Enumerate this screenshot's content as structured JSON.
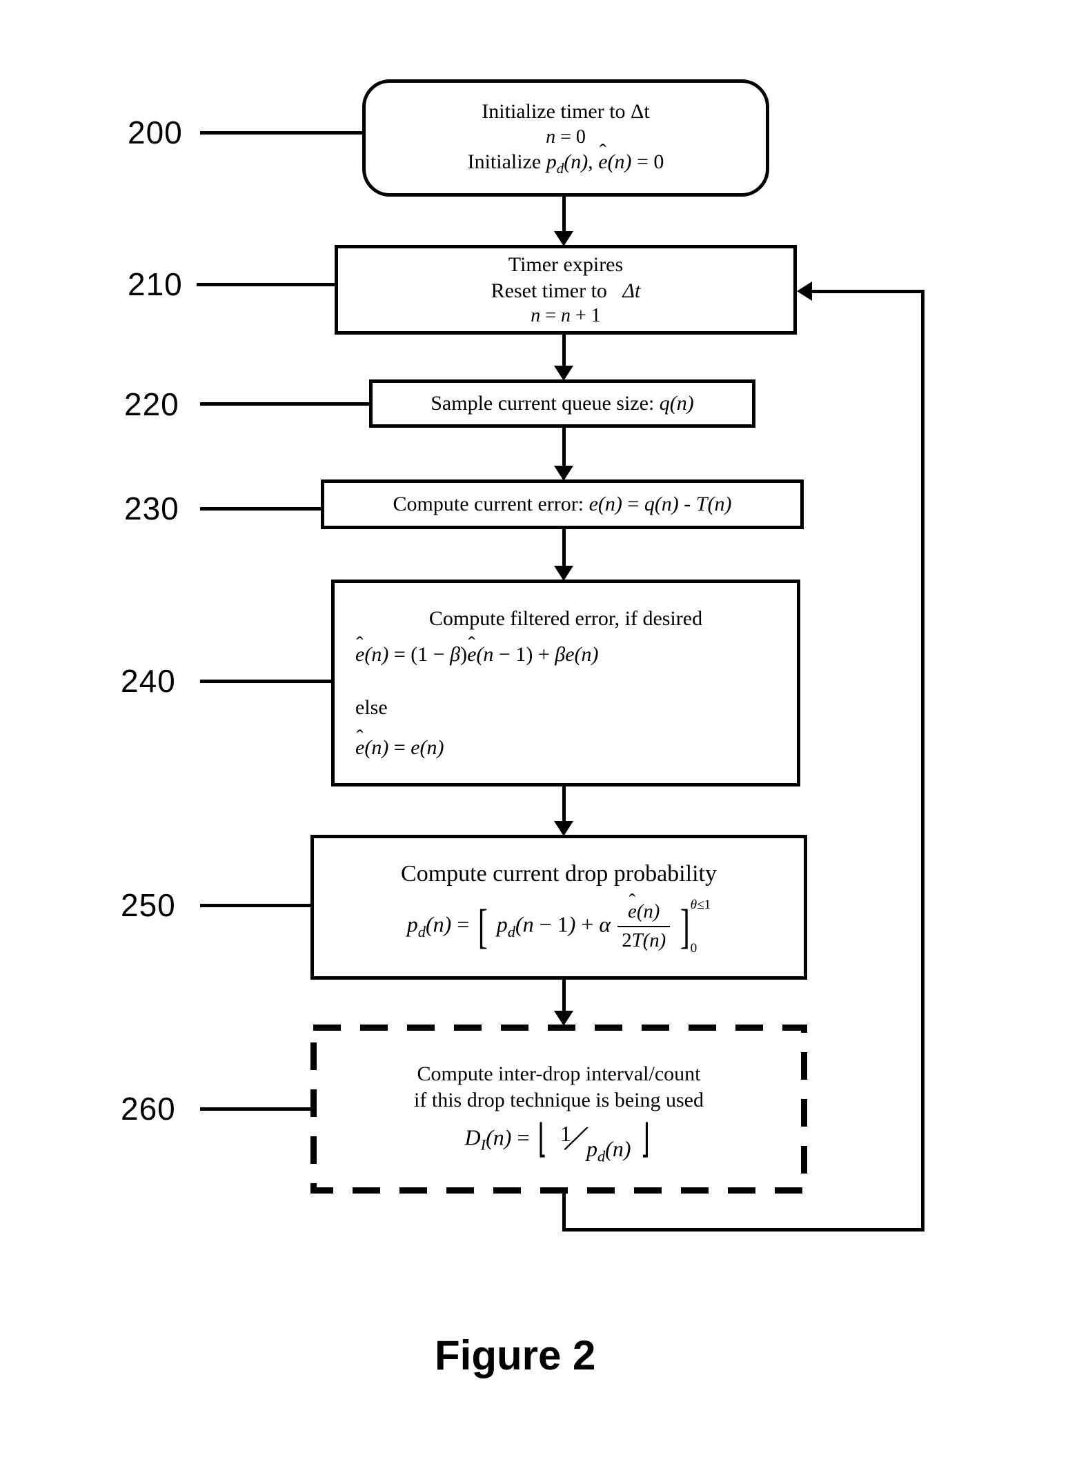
{
  "figure_caption": "Figure 2",
  "labels": {
    "l200": "200",
    "l210": "210",
    "l220": "220",
    "l230": "230",
    "l240": "240",
    "l250": "250",
    "l260": "260"
  },
  "steps": {
    "s200": {
      "line1": "Initialize timer to Δt",
      "line2": "n = 0",
      "line3_prefix": "Initialize ",
      "line3_math": "p_d(n), ê(n) = 0"
    },
    "s210": {
      "line1": "Timer expires",
      "line2_a": "Reset timer to",
      "line2_b": "Δt",
      "line3": "n = n + 1"
    },
    "s220": {
      "text": "Sample current queue size: q(n)"
    },
    "s230": {
      "text": "Compute current error: e(n) = q(n) - T(n)"
    },
    "s240": {
      "line1": "Compute filtered error, if desired",
      "eq1": "ê(n) = (1 − β) ê(n − 1) + β e(n)",
      "else": "else",
      "eq2": "ê(n) = e(n)"
    },
    "s250": {
      "line1": "Compute current drop probability",
      "eq_lhs": "p_d(n) =",
      "eq_inside_a": "p_d(n − 1) + α",
      "eq_frac_num": "ê(n)",
      "eq_frac_den": "2T(n)",
      "eq_upper": "θ ≤ 1",
      "eq_lower": "0"
    },
    "s260": {
      "line1": "Compute inter-drop interval/count",
      "line2": "if this drop technique is being used",
      "eq_lhs": "D_I(n) =",
      "eq_num": "1",
      "eq_den": "p_d(n)"
    }
  },
  "chart_data": {
    "type": "flowchart",
    "title": "Figure 2",
    "nodes": [
      {
        "id": "200",
        "shape": "rounded-rect",
        "text": "Initialize timer to Δt; n = 0; Initialize p_d(n), ê(n) = 0"
      },
      {
        "id": "210",
        "shape": "rect",
        "text": "Timer expires; Reset timer to Δt; n = n + 1"
      },
      {
        "id": "220",
        "shape": "rect",
        "text": "Sample current queue size: q(n)"
      },
      {
        "id": "230",
        "shape": "rect",
        "text": "Compute current error: e(n) = q(n) − T(n)"
      },
      {
        "id": "240",
        "shape": "rect",
        "text": "Compute filtered error, if desired: ê(n) = (1 − β) ê(n − 1) + β e(n); else ê(n) = e(n)"
      },
      {
        "id": "250",
        "shape": "rect",
        "text": "Compute current drop probability: p_d(n) = [ p_d(n − 1) + α · ê(n) / (2 T(n)) ] clipped to [0, θ] with θ ≤ 1"
      },
      {
        "id": "260",
        "shape": "dashed-rect",
        "text": "Compute inter-drop interval/count if this drop technique is being used: D_I(n) = floor( 1 / p_d(n) )"
      }
    ],
    "edges": [
      {
        "from": "200",
        "to": "210"
      },
      {
        "from": "210",
        "to": "220"
      },
      {
        "from": "220",
        "to": "230"
      },
      {
        "from": "230",
        "to": "240"
      },
      {
        "from": "240",
        "to": "250"
      },
      {
        "from": "250",
        "to": "260"
      },
      {
        "from": "260",
        "to": "210",
        "type": "feedback"
      }
    ]
  }
}
